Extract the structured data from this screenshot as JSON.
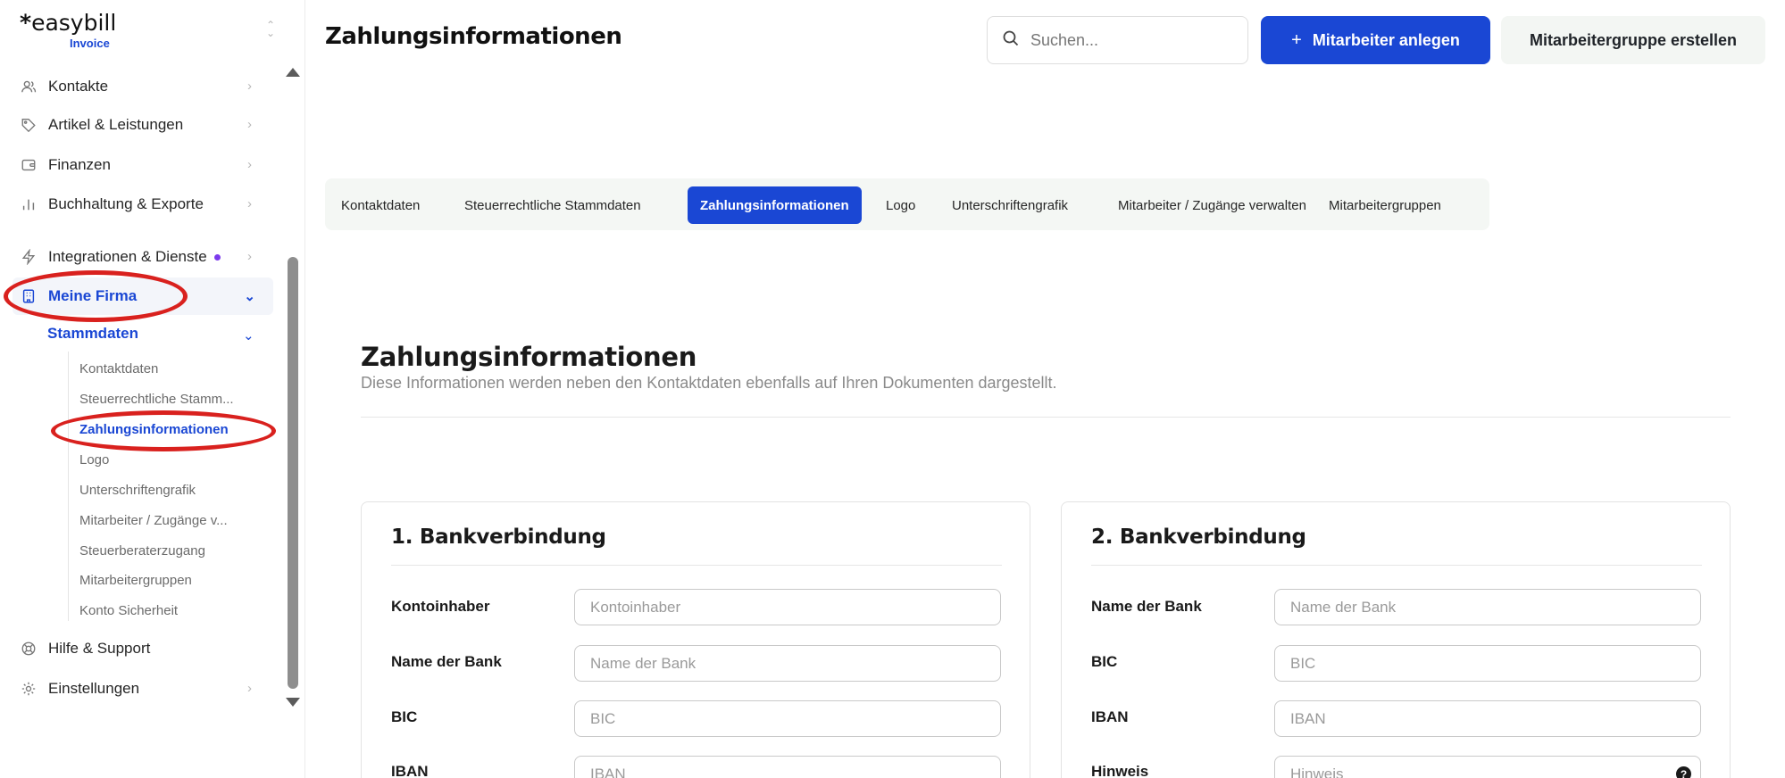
{
  "brand": {
    "name": "easybill",
    "star": "*",
    "product": "Invoice",
    "switch_icon": "chevrons-up-down-icon"
  },
  "sidebar": {
    "items": [
      {
        "label": "Kontakte",
        "icon": "users-icon"
      },
      {
        "label": "Artikel & Leistungen",
        "icon": "tag-icon"
      },
      {
        "label": "Finanzen",
        "icon": "wallet-icon"
      },
      {
        "label": "Buchhaltung & Exporte",
        "icon": "bar-chart-icon"
      },
      {
        "label": "Integrationen & Dienste",
        "icon": "bolt-icon"
      },
      {
        "label": "Meine Firma",
        "icon": "building-icon"
      },
      {
        "label": "Hilfe & Support",
        "icon": "lifebuoy-icon"
      },
      {
        "label": "Einstellungen",
        "icon": "gear-icon"
      }
    ],
    "submenu_title": "Stammdaten",
    "submenu": [
      "Kontaktdaten",
      "Steuerrechtliche Stamm...",
      "Zahlungsinformationen",
      "Logo",
      "Unterschriftengrafik",
      "Mitarbeiter / Zugänge v...",
      "Steuerberaterzugang",
      "Mitarbeitergruppen",
      "Konto Sicherheit"
    ]
  },
  "header": {
    "title": "Zahlungsinformationen",
    "search_placeholder": "Suchen...",
    "primary_button_plus": "+",
    "primary_button": "Mitarbeiter anlegen",
    "secondary_button": "Mitarbeitergruppe erstellen"
  },
  "tabs": [
    "Kontaktdaten",
    "Steuerrechtliche Stammdaten",
    "Zahlungsinformationen",
    "Logo",
    "Unterschriftengrafik",
    "Mitarbeiter / Zugänge verwalten",
    "Mitarbeitergruppen"
  ],
  "section": {
    "title": "Zahlungsinformationen",
    "description": "Diese Informationen werden neben den Kontaktdaten ebenfalls auf Ihren Dokumenten dargestellt."
  },
  "bank1": {
    "title": "1. Bankverbindung",
    "fields": [
      {
        "label": "Kontoinhaber",
        "placeholder": "Kontoinhaber"
      },
      {
        "label": "Name der Bank",
        "placeholder": "Name der Bank"
      },
      {
        "label": "BIC",
        "placeholder": "BIC"
      },
      {
        "label": "IBAN",
        "placeholder": "IBAN"
      }
    ]
  },
  "bank2": {
    "title": "2. Bankverbindung",
    "fields": [
      {
        "label": "Name der Bank",
        "placeholder": "Name der Bank"
      },
      {
        "label": "BIC",
        "placeholder": "BIC"
      },
      {
        "label": "IBAN",
        "placeholder": "IBAN"
      },
      {
        "label": "Hinweis",
        "placeholder": "Hinweis",
        "help_icon": "?"
      }
    ]
  },
  "colors": {
    "accent": "#1a47d4",
    "annotation": "#d9211e",
    "notification_dot": "#7c3aed"
  }
}
